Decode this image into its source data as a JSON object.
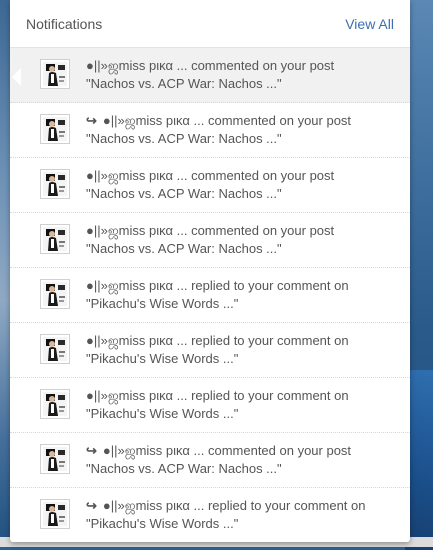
{
  "header": {
    "title": "Notifications",
    "view_all": "View All"
  },
  "notifications": [
    {
      "reply": false,
      "actor": "●||»ஜmiss pικα ...",
      "action": "commented on your post",
      "target": "\"Nachos vs. ACP War: Nachos ...\""
    },
    {
      "reply": true,
      "actor": "●||»ஜmiss pικα ...",
      "action": "commented on your post",
      "target": "\"Nachos vs. ACP War: Nachos ...\""
    },
    {
      "reply": false,
      "actor": "●||»ஜmiss pικα ...",
      "action": "commented on your post",
      "target": "\"Nachos vs. ACP War: Nachos ...\""
    },
    {
      "reply": false,
      "actor": "●||»ஜmiss pικα ...",
      "action": "commented on your post",
      "target": "\"Nachos vs. ACP War: Nachos ...\""
    },
    {
      "reply": false,
      "actor": "●||»ஜmiss pικα ...",
      "action": "replied to your comment on",
      "target": "\"Pikachu's Wise Words ...\""
    },
    {
      "reply": false,
      "actor": "●||»ஜmiss pικα ...",
      "action": "replied to your comment on",
      "target": "\"Pikachu's Wise Words ...\""
    },
    {
      "reply": false,
      "actor": "●||»ஜmiss pικα ...",
      "action": "replied to your comment on",
      "target": "\"Pikachu's Wise Words ...\""
    },
    {
      "reply": true,
      "actor": "●||»ஜmiss pικα ...",
      "action": "commented on your post",
      "target": "\"Nachos vs. ACP War: Nachos ...\""
    },
    {
      "reply": true,
      "actor": "●||»ஜmiss pικα ...",
      "action": "replied to your comment on",
      "target": "\"Pikachu's Wise Words ...\""
    }
  ],
  "icons": {
    "reply": "↪"
  },
  "colors": {
    "link": "#3c6fb0",
    "text": "#555555",
    "highlight_row": "#f1f1f1"
  }
}
